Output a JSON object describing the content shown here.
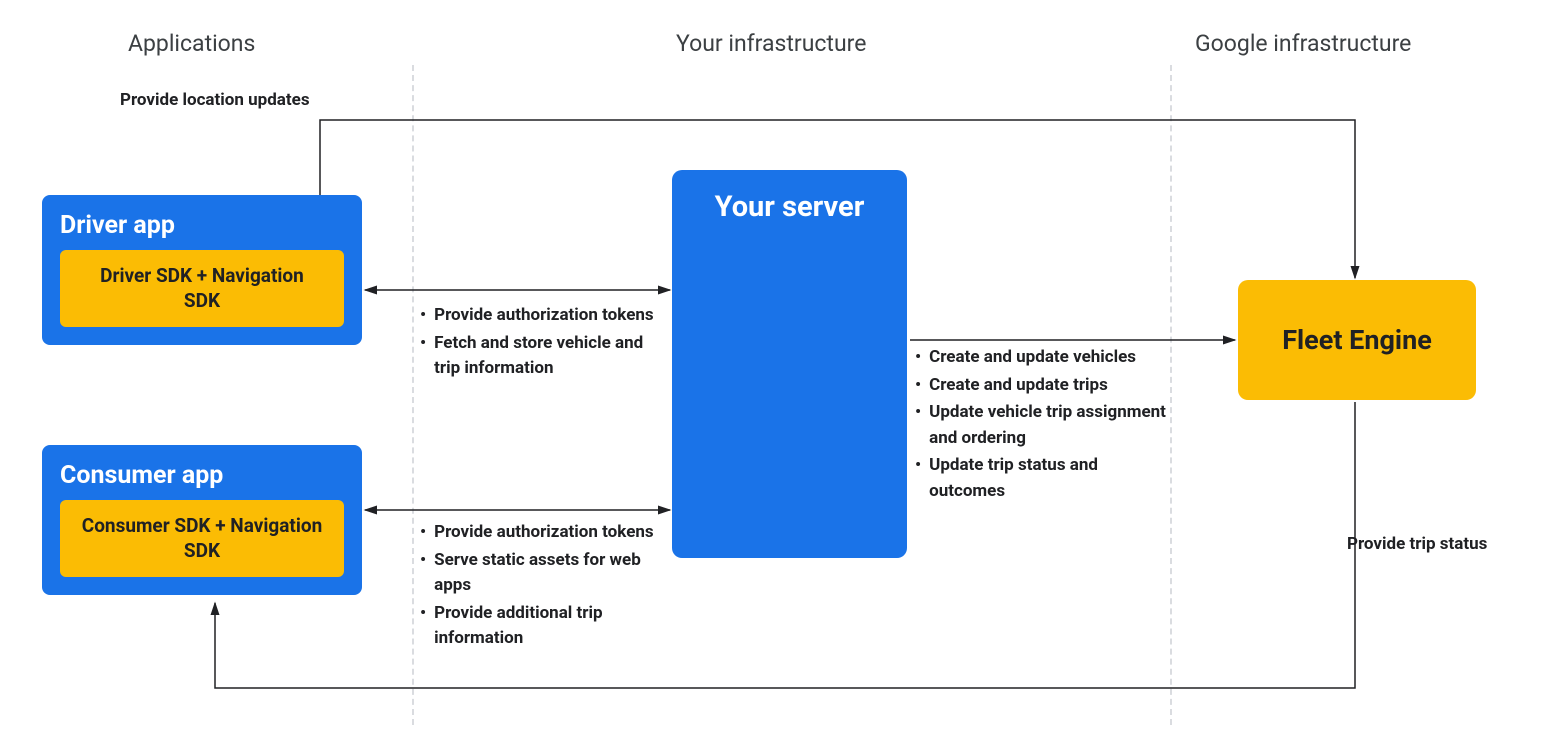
{
  "sections": {
    "applications": "Applications",
    "your_infra": "Your infrastructure",
    "google_infra": "Google infrastructure"
  },
  "boxes": {
    "driver_app": {
      "title": "Driver app",
      "sdk": "Driver SDK + Navigation SDK"
    },
    "consumer_app": {
      "title": "Consumer app",
      "sdk": "Consumer SDK + Navigation SDK"
    },
    "server": "Your server",
    "fleet": "Fleet Engine"
  },
  "annotations": {
    "top": "Provide location updates",
    "bottom": "Provide trip status"
  },
  "bullets": {
    "driver_server": [
      "Provide authorization tokens",
      "Fetch and store vehicle and trip information"
    ],
    "consumer_server": [
      "Provide authorization tokens",
      "Serve static assets for web apps",
      "Provide additional trip information"
    ],
    "server_fleet": [
      "Create and update vehicles",
      "Create and update trips",
      "Update vehicle trip assignment and ordering",
      "Update trip status and outcomes"
    ]
  }
}
